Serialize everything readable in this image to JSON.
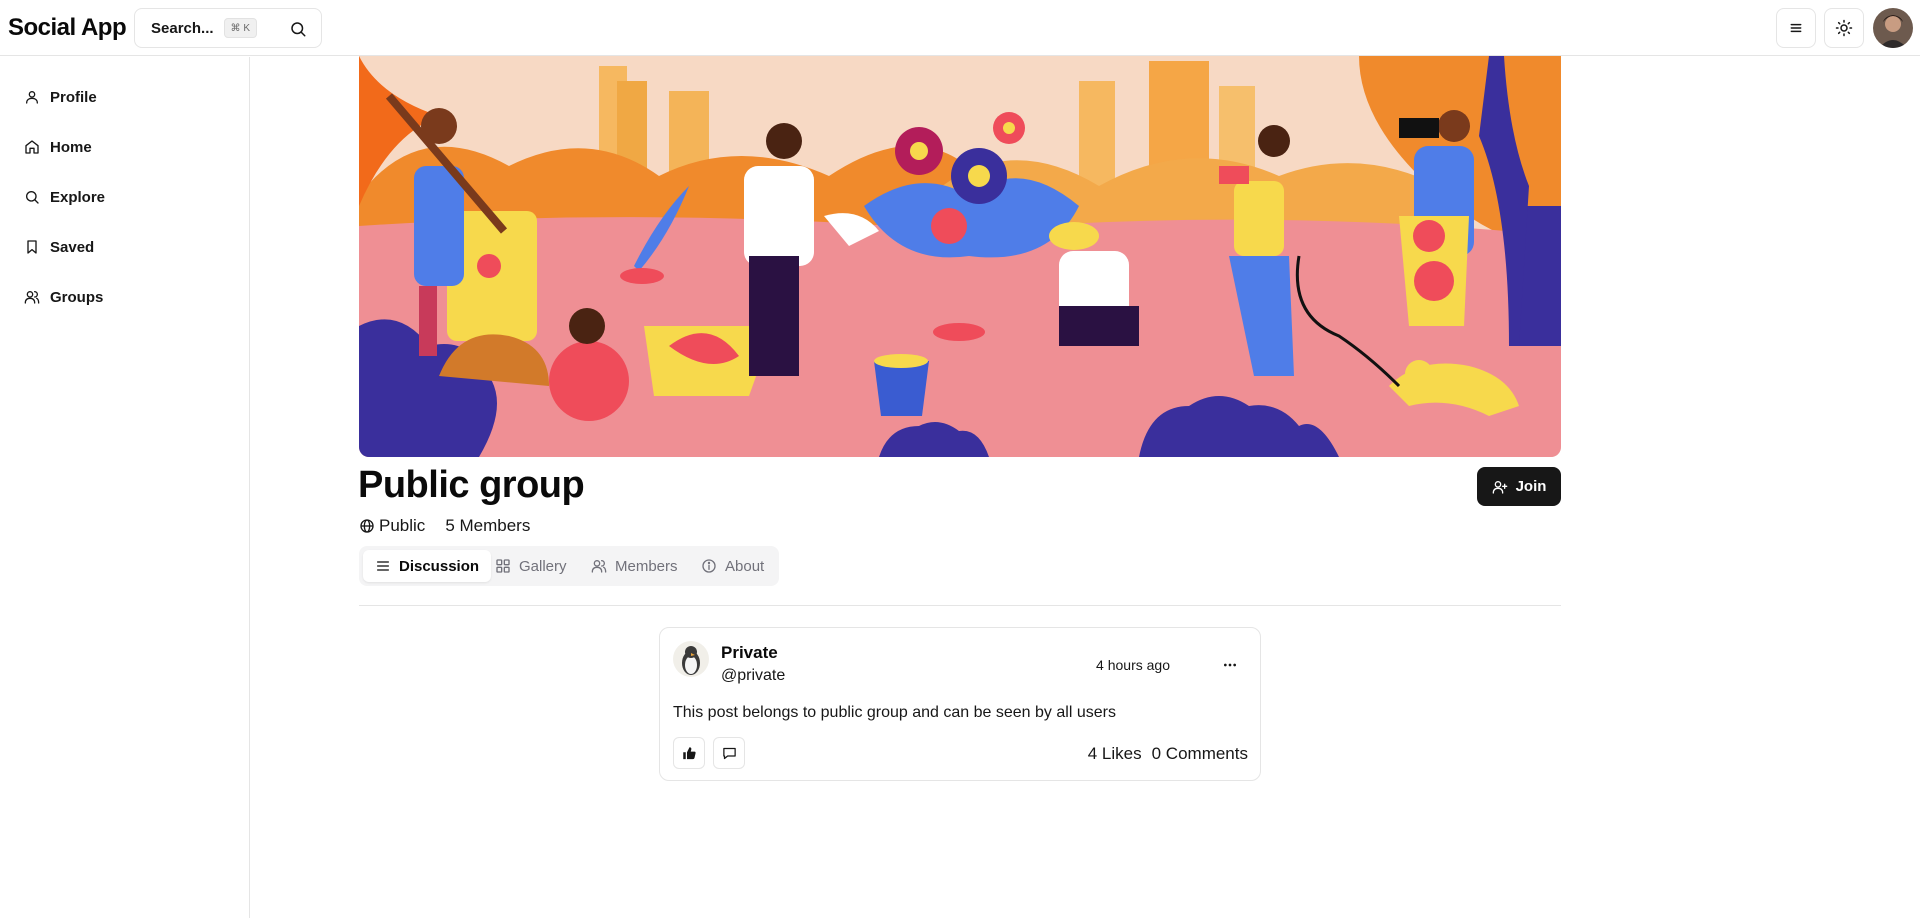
{
  "app": {
    "title": "Social App"
  },
  "search": {
    "placeholder": "Search...",
    "shortcut": "⌘ K"
  },
  "header": {
    "icons": [
      "menu-icon",
      "sun-icon",
      "user-avatar"
    ]
  },
  "sidebar": {
    "items": [
      {
        "label": "Profile",
        "icon": "user-icon"
      },
      {
        "label": "Home",
        "icon": "home-icon"
      },
      {
        "label": "Explore",
        "icon": "search-icon"
      },
      {
        "label": "Saved",
        "icon": "bookmark-icon"
      },
      {
        "label": "Groups",
        "icon": "users-icon"
      }
    ]
  },
  "group": {
    "title": "Public group",
    "visibility": "Public",
    "members": "5 Members",
    "join_label": "Join"
  },
  "tabs": [
    {
      "label": "Discussion",
      "icon": "list-icon",
      "active": true
    },
    {
      "label": "Gallery",
      "icon": "grid-icon",
      "active": false
    },
    {
      "label": "Members",
      "icon": "users-icon",
      "active": false
    },
    {
      "label": "About",
      "icon": "info-icon",
      "active": false
    }
  ],
  "post": {
    "author": "Private",
    "handle": "@private",
    "time": "4 hours ago",
    "body": "This post belongs to public group and can be seen by all users",
    "likes": "4 Likes",
    "comments": "0 Comments"
  },
  "colors": {
    "accent": "#171717",
    "border": "#e5e5e5",
    "tab_bg": "#f4f4f5",
    "cover_pink": "#ef8f94",
    "cover_orange": "#f08a2c",
    "cover_navy": "#3a2f9c"
  }
}
